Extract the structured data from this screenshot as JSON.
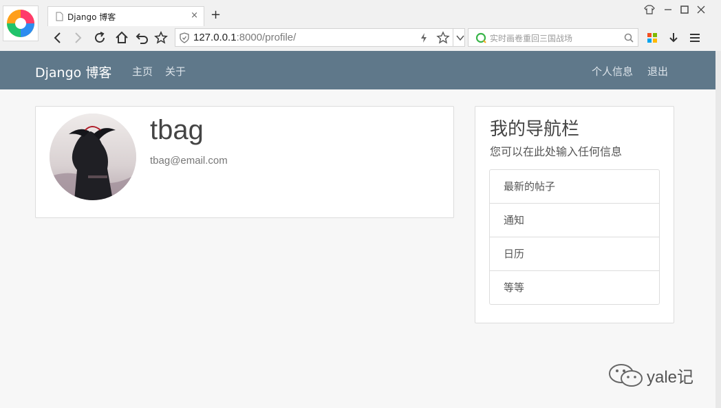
{
  "browser": {
    "tab_title": "Django 博客",
    "tab_close": "×",
    "new_tab": "+",
    "url_host": "127.0.0.1",
    "url_rest": ":8000/profile/",
    "search_placeholder": "实时画卷重回三国战场"
  },
  "navbar": {
    "brand": "Django 博客",
    "links": [
      "主页",
      "关于"
    ],
    "right_links": [
      "个人信息",
      "退出"
    ],
    "background": "#5f788a"
  },
  "profile": {
    "username": "tbag",
    "email": "tbag@email.com"
  },
  "sidebar": {
    "title": "我的导航栏",
    "description": "您可以在此处输入任何信息",
    "items": [
      "最新的帖子",
      "通知",
      "日历",
      "等等"
    ]
  },
  "watermark": {
    "text": "yale记"
  }
}
